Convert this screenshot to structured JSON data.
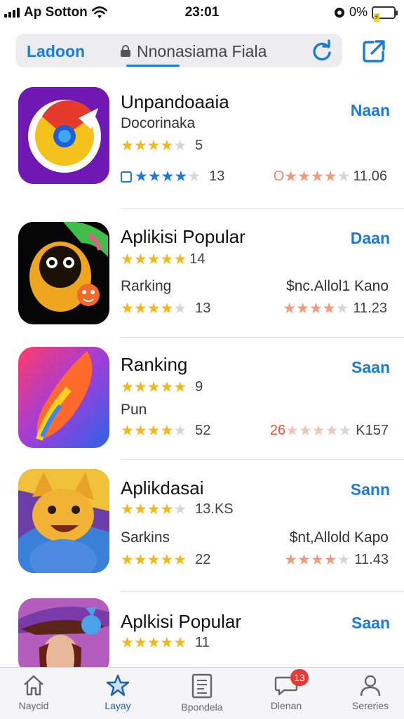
{
  "status_bar": {
    "carrier": "Ap Sotton",
    "time": "23:01",
    "battery_text": "0%",
    "icons": [
      "signal-icon",
      "wifi-icon",
      "alarm-icon",
      "battery-icon"
    ]
  },
  "address_bar": {
    "tab_label": "Ladoon",
    "url": "Nnonasiama Fiala",
    "icons": [
      "lock-icon",
      "reload-icon",
      "share-icon"
    ]
  },
  "accent_color": "#1c7bd8",
  "apps": [
    {
      "name": "Unpandoaaia",
      "action": "Naan",
      "subtitle": "Docorinaka",
      "rating1": "5",
      "rating1_stars": 4,
      "rating2": "13",
      "rating2_stars": 4,
      "price": "",
      "rating3": "11.06",
      "rating3_prefix": "O",
      "rating3_stars": 4,
      "icon": "browser-app-icon"
    },
    {
      "name": "Aplikisi Popular",
      "action": "Daan",
      "subtitle": "Rarking",
      "rating1": "14",
      "rating1_stars": 5,
      "rating2": "13",
      "rating2_stars": 4,
      "price": "$nc.Allol1 Kano",
      "rating3": "11.23",
      "rating3_prefix": "",
      "rating3_stars": 4,
      "icon": "monster-app-icon"
    },
    {
      "name": "Ranking",
      "action": "Saan",
      "subtitle": "Pun",
      "rating1": "9",
      "rating1_stars": 5,
      "rating2": "52",
      "rating2_stars": 4,
      "price": "",
      "rating3": "K157",
      "rating3_prefix": "26",
      "rating3_stars": 4,
      "icon": "feather-app-icon"
    },
    {
      "name": "Aplikdasai",
      "action": "Sann",
      "subtitle": "Sarkins",
      "rating1": "13.KS",
      "rating1_stars": 4,
      "rating2": "22",
      "rating2_stars": 5,
      "price": "$nt,Allold Kapo",
      "rating3": "11.43",
      "rating3_prefix": "",
      "rating3_stars": 4,
      "icon": "fox-app-icon"
    },
    {
      "name": "Aplkisi Popular",
      "action": "Saan",
      "subtitle": "",
      "rating1": "11",
      "rating1_stars": 5,
      "rating2": "",
      "rating2_stars": 0,
      "price": "",
      "rating3": "",
      "rating3_prefix": "",
      "rating3_stars": 0,
      "icon": "witch-app-icon"
    }
  ],
  "tabs": [
    {
      "label": "Naycid",
      "icon": "home-icon"
    },
    {
      "label": "Layay",
      "icon": "star-icon"
    },
    {
      "label": "Bpondela",
      "icon": "document-icon"
    },
    {
      "label": "Dlenan",
      "icon": "chat-icon",
      "badge": "13"
    },
    {
      "label": "Sereries",
      "icon": "person-icon"
    }
  ]
}
